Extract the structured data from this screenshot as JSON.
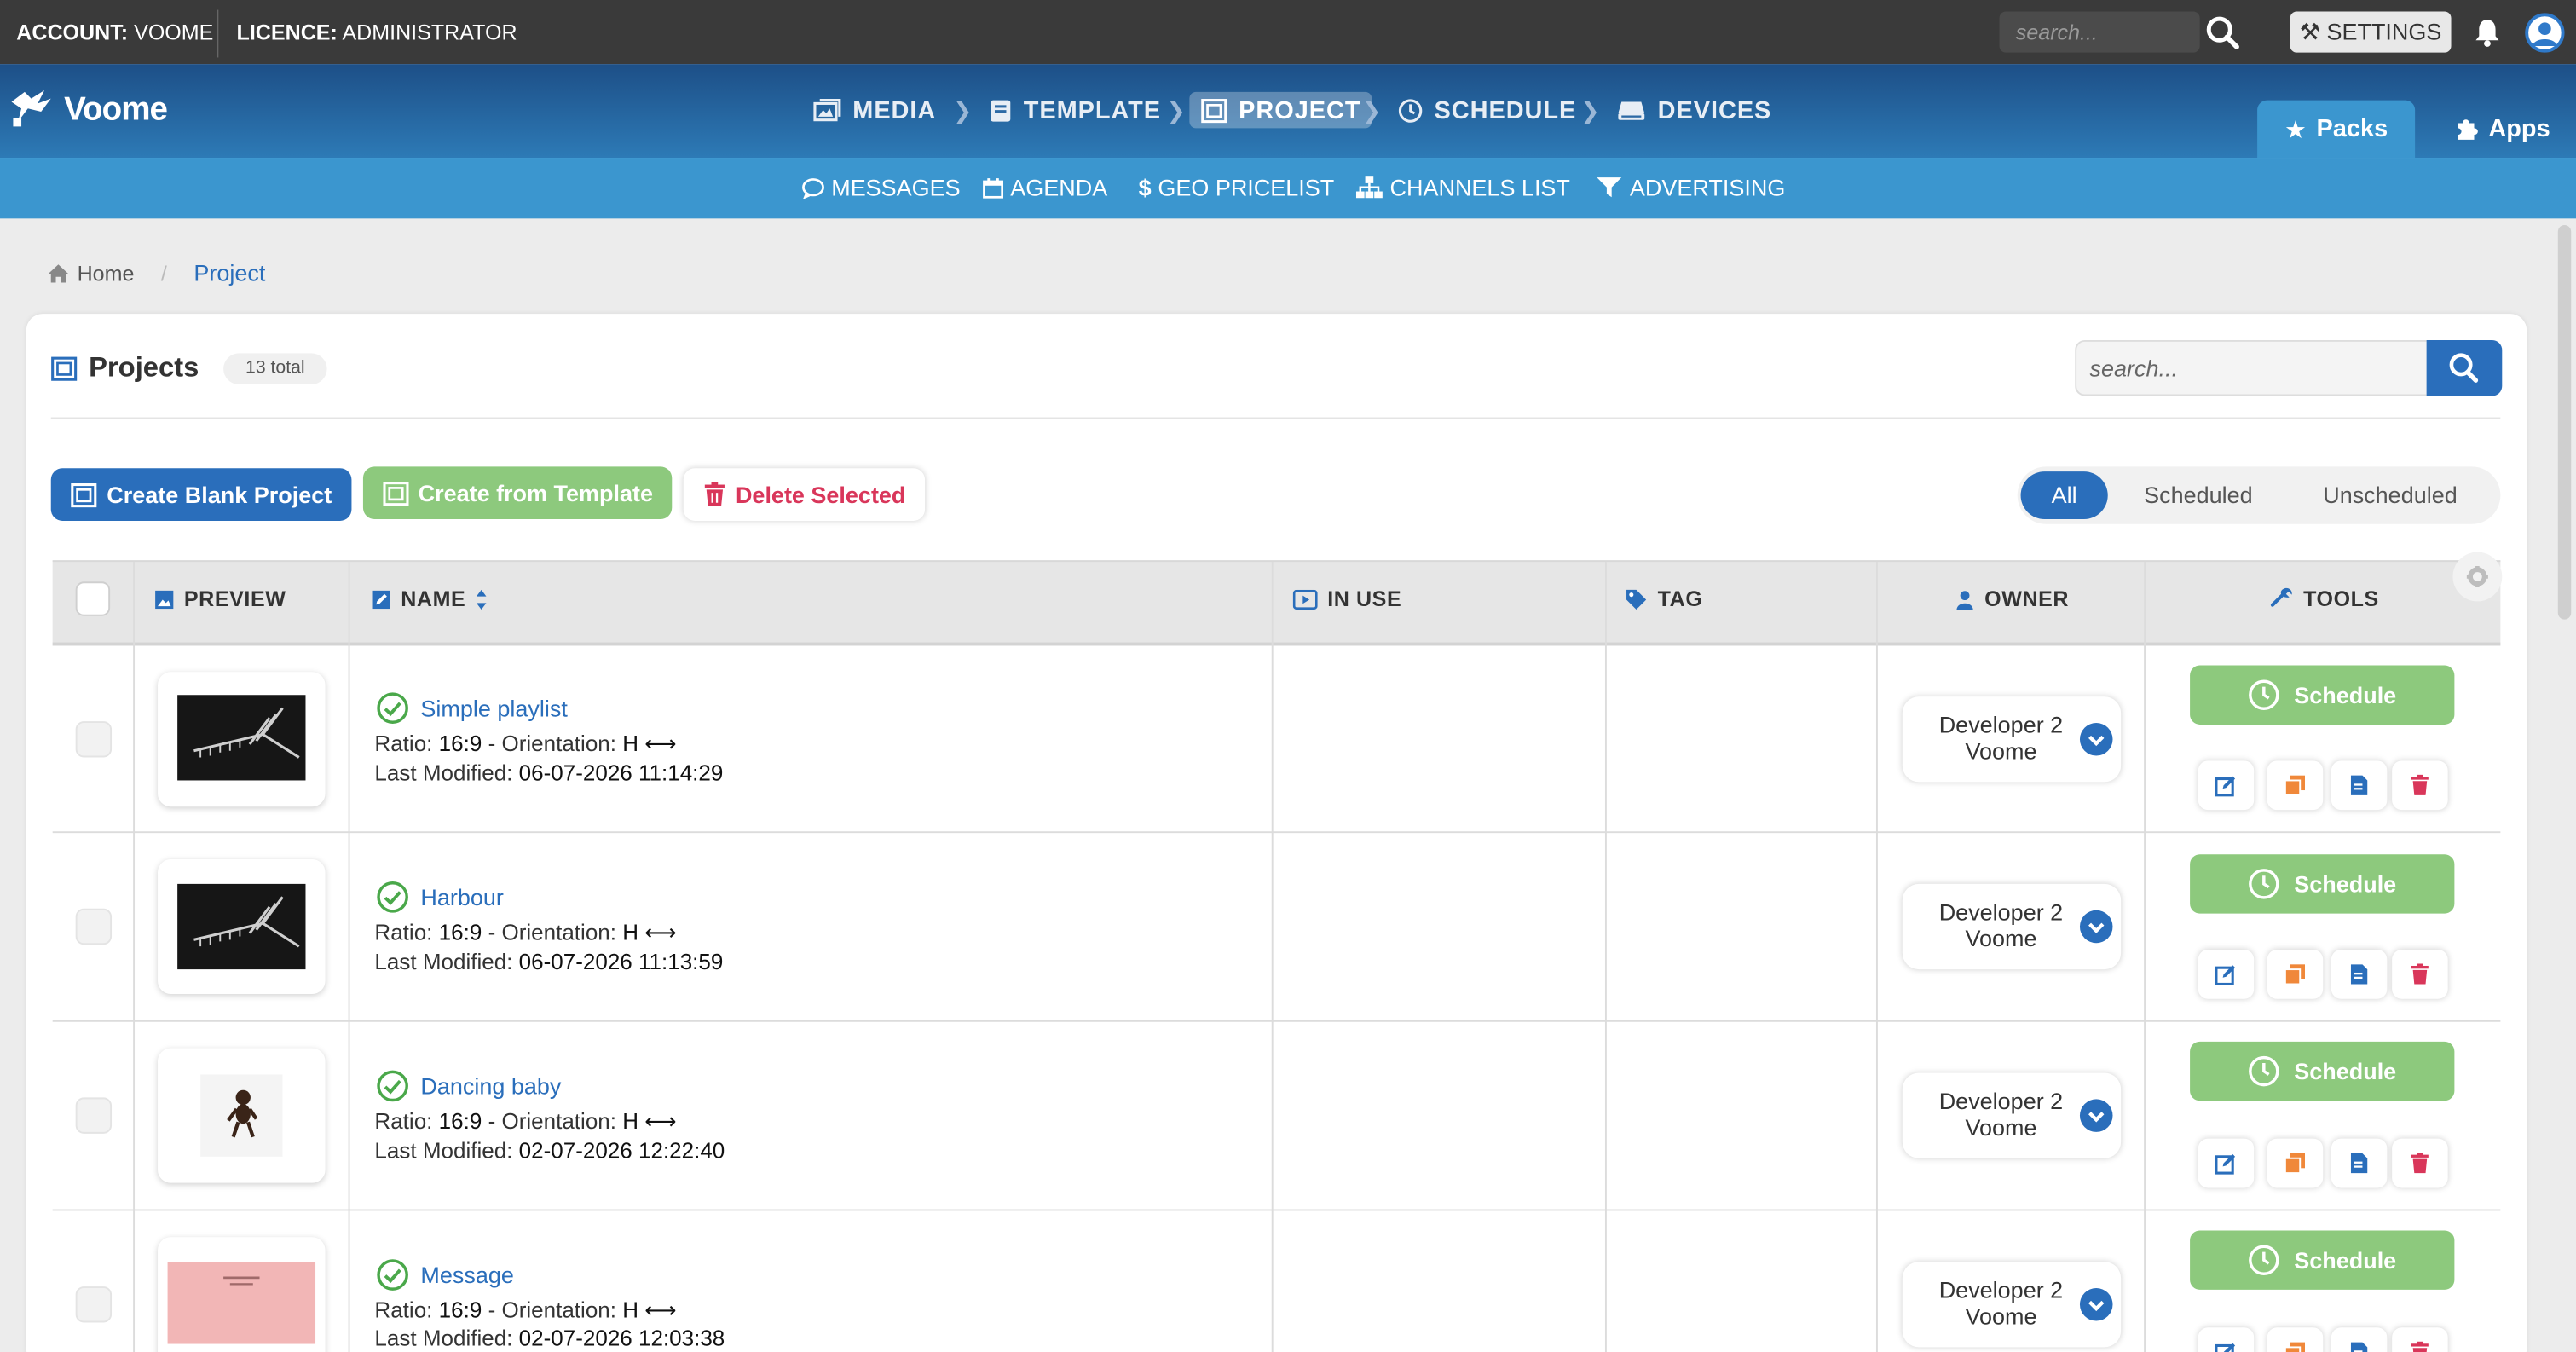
{
  "topbar": {
    "account_label": "ACCOUNT:",
    "account_value": "VOOME",
    "licence_label": "LICENCE:",
    "licence_value": "ADMINISTRATOR",
    "search_placeholder": "search...",
    "settings_label": "SETTINGS"
  },
  "brand": {
    "name": "Voome"
  },
  "mainnav": {
    "items": [
      {
        "label": "MEDIA",
        "icon": "images-icon"
      },
      {
        "label": "TEMPLATE",
        "icon": "book-icon"
      },
      {
        "label": "PROJECT",
        "icon": "project-icon",
        "active": true
      },
      {
        "label": "SCHEDULE",
        "icon": "clock-icon"
      },
      {
        "label": "DEVICES",
        "icon": "devices-icon"
      }
    ],
    "packs_label": "Packs",
    "apps_label": "Apps"
  },
  "subnav": {
    "items": [
      {
        "label": "MESSAGES",
        "icon": "comment-icon"
      },
      {
        "label": "AGENDA",
        "icon": "calendar-icon"
      },
      {
        "label": "GEO PRICELIST",
        "icon": "dollar-icon"
      },
      {
        "label": "CHANNELS LIST",
        "icon": "sitemap-icon"
      },
      {
        "label": "ADVERTISING",
        "icon": "filter-icon"
      }
    ]
  },
  "breadcrumb": {
    "home": "Home",
    "current": "Project"
  },
  "card": {
    "title": "Projects",
    "total": "13 total",
    "search_placeholder": "search...",
    "create_blank": "Create Blank Project",
    "create_template": "Create from Template",
    "delete_selected": "Delete Selected",
    "filters": [
      "All",
      "Scheduled",
      "Unscheduled"
    ],
    "active_filter": "All"
  },
  "table": {
    "columns": [
      "PREVIEW",
      "NAME",
      "IN USE",
      "TAG",
      "OWNER",
      "TOOLS"
    ],
    "rows": [
      {
        "name": "Simple playlist",
        "ratio_label": "Ratio:",
        "ratio": "16:9",
        "orientation_label": "- Orientation:",
        "orientation": "H ⟷",
        "modified_label": "Last Modified:",
        "modified": "06-07-2026 11:14:29",
        "owner_line1": "Developer 2",
        "owner_line2": "Voome",
        "schedule_label": "Schedule",
        "thumb": "dark"
      },
      {
        "name": "Harbour",
        "ratio_label": "Ratio:",
        "ratio": "16:9",
        "orientation_label": "- Orientation:",
        "orientation": "H ⟷",
        "modified_label": "Last Modified:",
        "modified": "06-07-2026 11:13:59",
        "owner_line1": "Developer 2",
        "owner_line2": "Voome",
        "schedule_label": "Schedule",
        "thumb": "dark"
      },
      {
        "name": "Dancing baby",
        "ratio_label": "Ratio:",
        "ratio": "16:9",
        "orientation_label": "- Orientation:",
        "orientation": "H ⟷",
        "modified_label": "Last Modified:",
        "modified": "02-07-2026 12:22:40",
        "owner_line1": "Developer 2",
        "owner_line2": "Voome",
        "schedule_label": "Schedule",
        "thumb": "baby"
      },
      {
        "name": "Message",
        "ratio_label": "Ratio:",
        "ratio": "16:9",
        "orientation_label": "- Orientation:",
        "orientation": "H ⟷",
        "modified_label": "Last Modified:",
        "modified": "02-07-2026 12:03:38",
        "owner_line1": "Developer 2",
        "owner_line2": "Voome",
        "schedule_label": "Schedule",
        "thumb": "pink"
      }
    ]
  },
  "colors": {
    "primary": "#2a6ebb",
    "success": "#8dc97d",
    "danger": "#d9365a",
    "orange": "#f0883a",
    "topbar": "#3a3a3a",
    "nav": "#2d7ab6",
    "subnav": "#3b96cf"
  }
}
